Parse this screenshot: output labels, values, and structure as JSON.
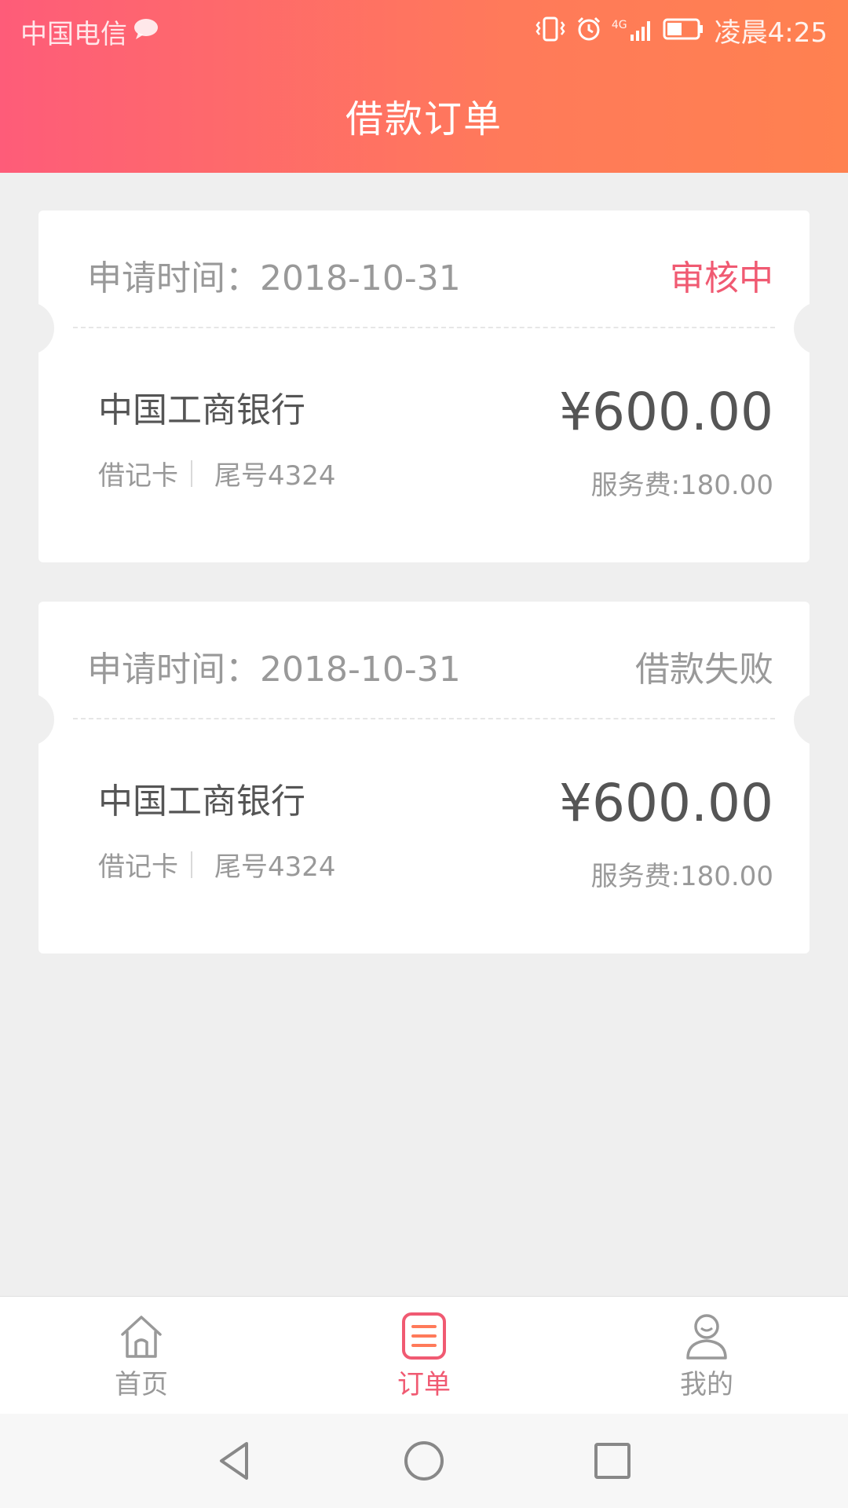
{
  "statusbar": {
    "carrier": "中国电信",
    "time": "凌晨4:25",
    "network": "4G"
  },
  "header": {
    "title": "借款订单"
  },
  "orders": [
    {
      "apply_label": "申请时间：2018-10-31",
      "status": "审核中",
      "status_color": "#f05a72",
      "bank": "中国工商银行",
      "card_type": "借记卡",
      "card_tail": "尾号4324",
      "amount": "¥600.00",
      "fee": "服务费:180.00"
    },
    {
      "apply_label": "申请时间：2018-10-31",
      "status": "借款失败",
      "status_color": "#999999",
      "bank": "中国工商银行",
      "card_type": "借记卡",
      "card_tail": "尾号4324",
      "amount": "¥600.00",
      "fee": "服务费:180.00"
    }
  ],
  "tabbar": {
    "items": [
      {
        "label": "首页",
        "icon": "home-icon",
        "active": false
      },
      {
        "label": "订单",
        "icon": "order-list-icon",
        "active": true
      },
      {
        "label": "我的",
        "icon": "user-icon",
        "active": false
      }
    ],
    "active_color": "#f05a72",
    "inactive_color": "#999999"
  },
  "navbar": {
    "icons": [
      "back-icon",
      "home-circle-icon",
      "recents-icon"
    ]
  }
}
